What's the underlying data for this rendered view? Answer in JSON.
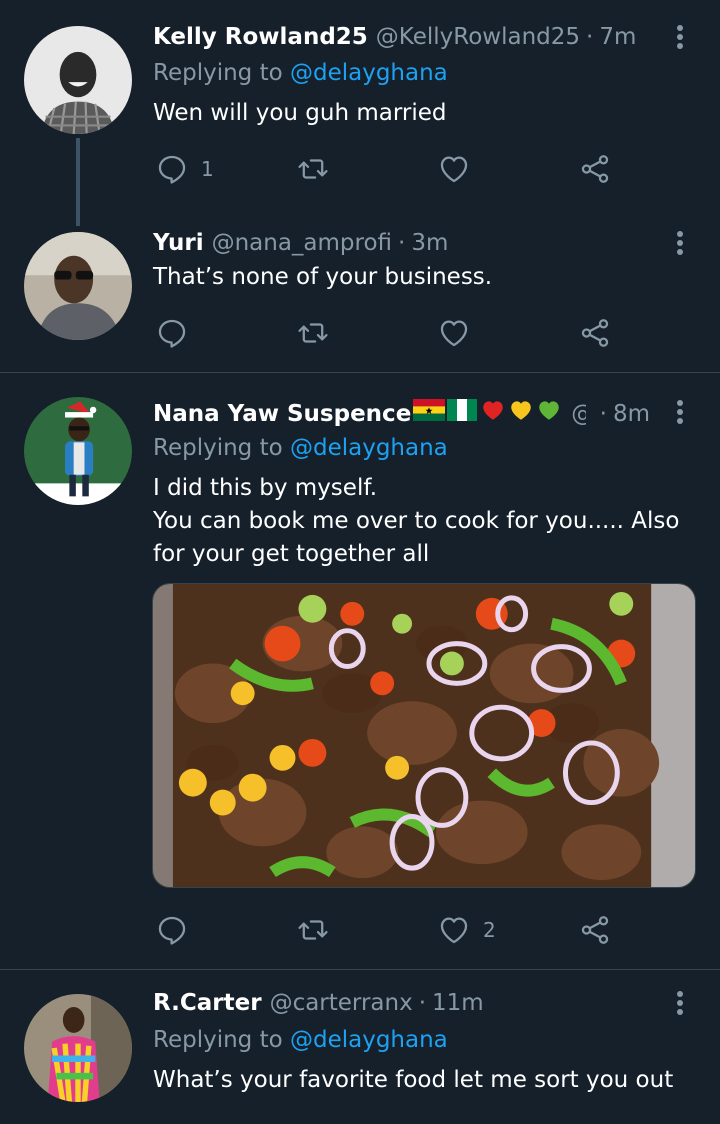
{
  "tweets": [
    {
      "name": "Kelly Rowland25",
      "handle": "@KellyRowland25",
      "time": "7m",
      "replying_prefix": "Replying to ",
      "replying_to": "@delayghana",
      "text": "Wen will you guh married",
      "reply_count": "1",
      "like_count": ""
    },
    {
      "name": "Yuri",
      "handle": "@nana_amprofi",
      "time": "3m",
      "text": "That’s none of your business.",
      "reply_count": "",
      "like_count": ""
    },
    {
      "name": "Nana Yaw Suspence",
      "handle": "@...",
      "time": "8m",
      "replying_prefix": "Replying to ",
      "replying_to": "@delayghana",
      "text": "I did this by myself.\nYou can book me over to cook for you..... Also for your get together all",
      "reply_count": "",
      "like_count": "2"
    },
    {
      "name": "R.Carter",
      "handle": "@carterranx",
      "time": "11m",
      "replying_prefix": "Replying to ",
      "replying_to": "@delayghana",
      "text": "What’s your favorite food let me sort you out"
    }
  ],
  "separator": "·",
  "icons": {
    "reply": "reply-icon",
    "retweet": "retweet-icon",
    "like": "heart-icon",
    "share": "share-icon",
    "more": "more-vertical-icon"
  },
  "colors": {
    "background": "#15202b",
    "secondary_text": "#8899a6",
    "mention": "#1da1f2",
    "divider": "#38444d"
  }
}
